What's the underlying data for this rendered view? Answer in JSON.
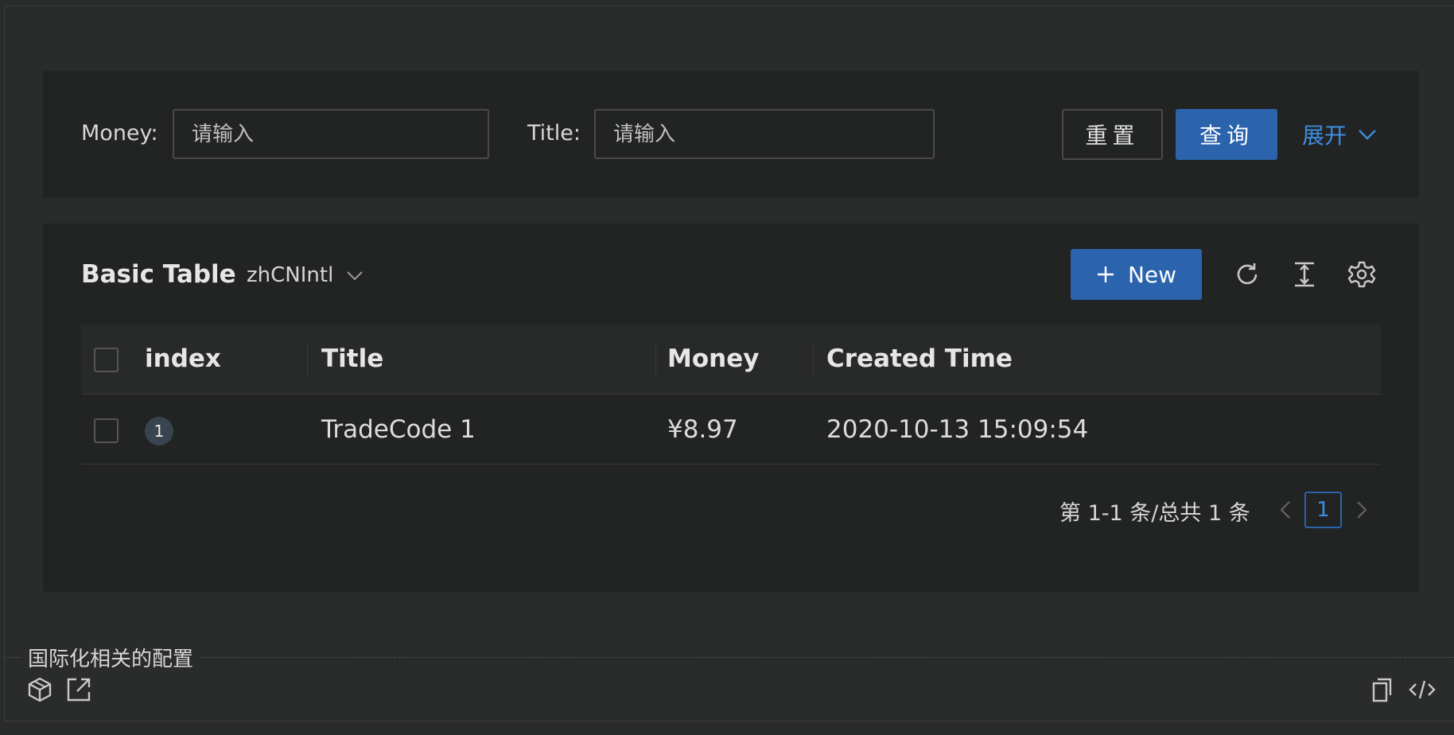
{
  "search": {
    "money_label": "Money:",
    "money_placeholder": "请输入",
    "title_label": "Title:",
    "title_placeholder": "请输入",
    "reset_label": "重置",
    "query_label": "查询",
    "expand_label": "展开"
  },
  "table": {
    "title": "Basic Table",
    "locale_value": "zhCNIntl",
    "new_label": "New",
    "columns": [
      "index",
      "Title",
      "Money",
      "Created Time"
    ],
    "rows": [
      {
        "index": "1",
        "title": "TradeCode 1",
        "money": "¥8.97",
        "created_time": "2020-10-13 15:09:54"
      }
    ]
  },
  "pagination": {
    "total_text": "第 1-1 条/总共 1 条",
    "current_page": "1"
  },
  "demo": {
    "caption": "国际化相关的配置"
  },
  "colors": {
    "primary": "#2b63ad",
    "link": "#3d8de0",
    "background": "#2a2b2b",
    "card": "#222323"
  }
}
